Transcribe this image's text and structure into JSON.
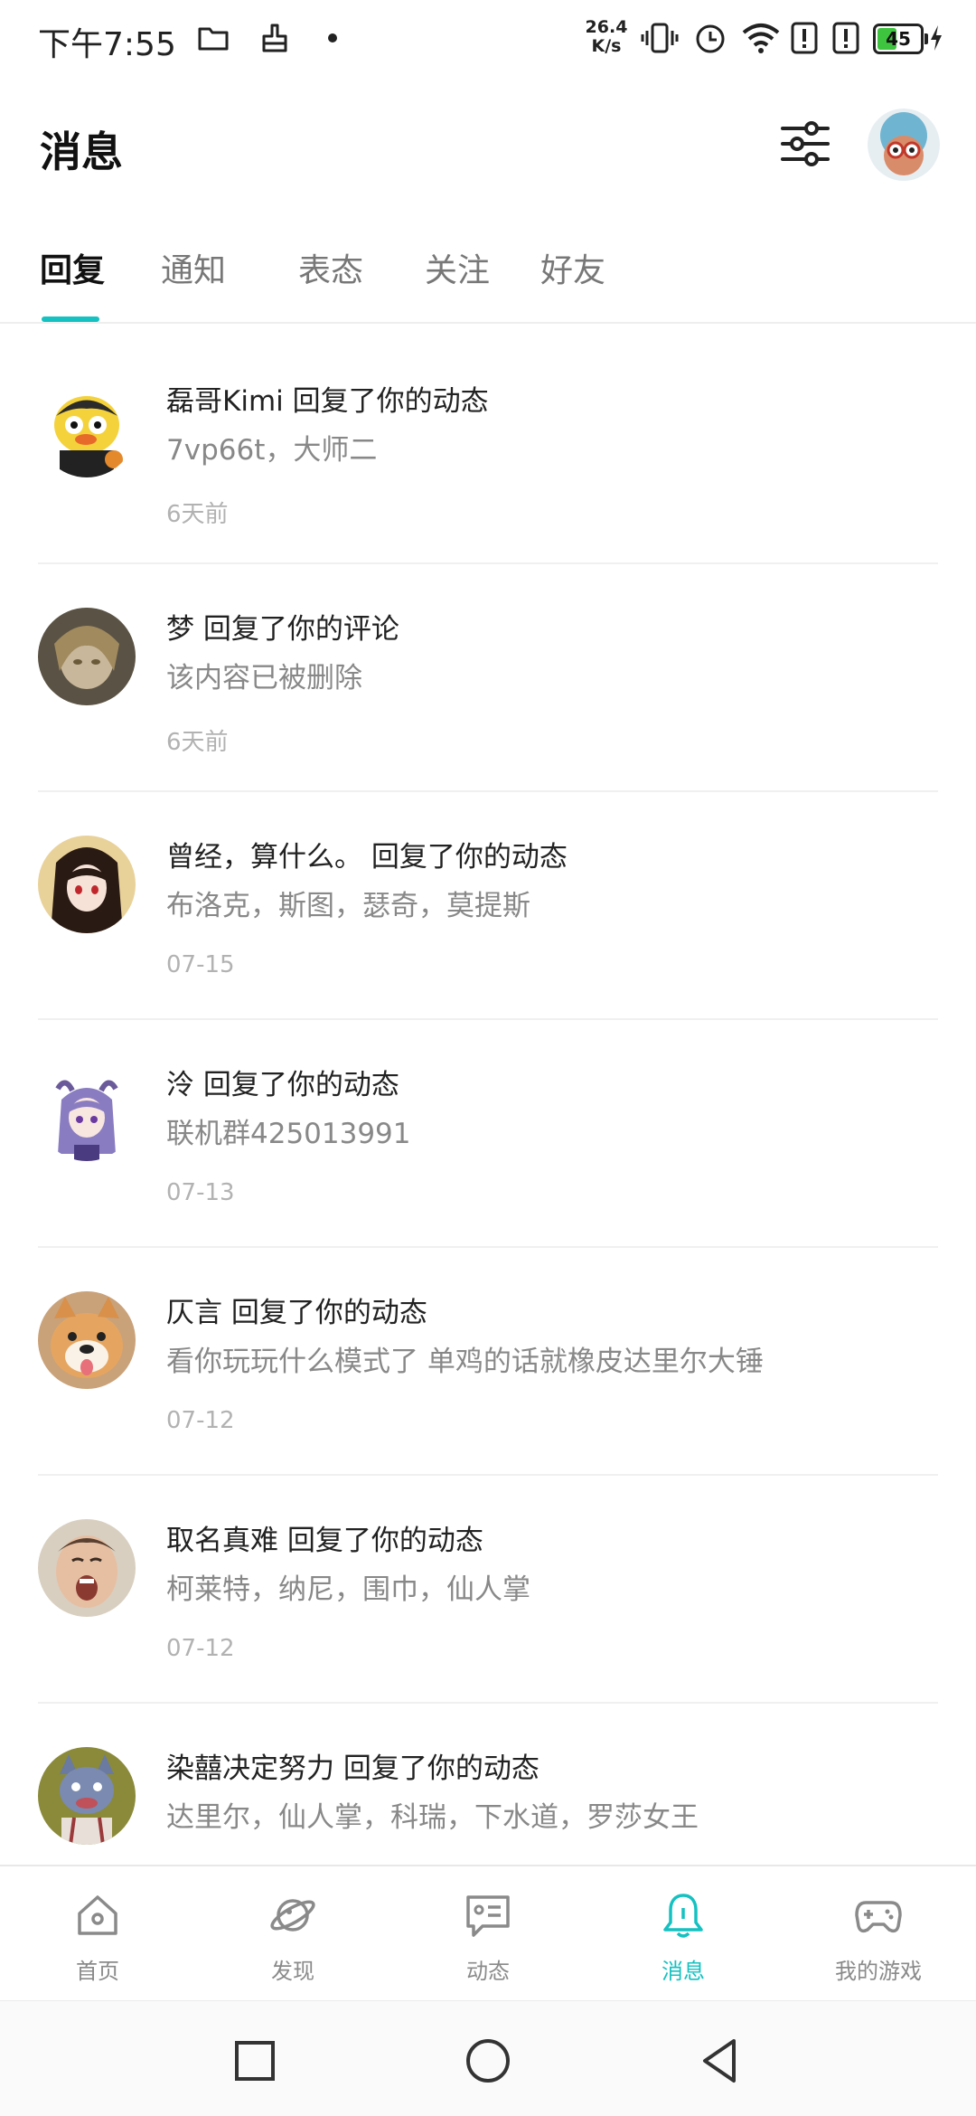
{
  "status_bar": {
    "time": "下午7:55",
    "net_speed_value": "26.4",
    "net_speed_unit": "K/s",
    "battery_level": "45",
    "battery_fraction": 0.45,
    "icons": [
      "folder-icon",
      "thumb-icon",
      "dot-icon",
      "vibrate-icon",
      "alarm-icon",
      "wifi-icon",
      "alert-icon",
      "alert-icon",
      "battery-icon",
      "charging-icon"
    ]
  },
  "header": {
    "title": "消息"
  },
  "tabs": [
    {
      "label": "回复",
      "active": true
    },
    {
      "label": "通知",
      "active": false
    },
    {
      "label": "表态",
      "active": false
    },
    {
      "label": "关注",
      "active": false
    },
    {
      "label": "好友",
      "active": false
    }
  ],
  "messages": [
    {
      "title": "磊哥Kimi 回复了你的动态",
      "content": "7vp66t，大师二",
      "time": "6天前"
    },
    {
      "title": "梦 回复了你的评论",
      "content": "该内容已被删除",
      "time": "6天前"
    },
    {
      "title": "曾经，算什么。 回复了你的动态",
      "content": "布洛克，斯图，瑟奇，莫提斯",
      "time": "07-15"
    },
    {
      "title": "泠 回复了你的动态",
      "content": "联机群425013991",
      "time": "07-13"
    },
    {
      "title": "仄言 回复了你的动态",
      "content": "看你玩玩什么模式了 单鸡的话就橡皮达里尔大锤",
      "time": "07-12"
    },
    {
      "title": "取名真难 回复了你的动态",
      "content": "柯莱特，纳尼，围巾，仙人掌",
      "time": "07-12"
    },
    {
      "title": "染囍决定努力 回复了你的动态",
      "content": "达里尔，仙人掌，科瑞，下水道，罗莎女王",
      "time": ""
    }
  ],
  "bottom_nav": [
    {
      "label": "首页",
      "icon": "home-icon",
      "active": false
    },
    {
      "label": "发现",
      "icon": "planet-icon",
      "active": false
    },
    {
      "label": "动态",
      "icon": "feed-icon",
      "active": false
    },
    {
      "label": "消息",
      "icon": "bell-icon",
      "active": true
    },
    {
      "label": "我的游戏",
      "icon": "gamepad-icon",
      "active": false
    }
  ],
  "colors": {
    "accent": "#15c1c1",
    "text_primary": "#222222",
    "text_secondary": "#888888",
    "text_muted": "#b2b2b2"
  }
}
